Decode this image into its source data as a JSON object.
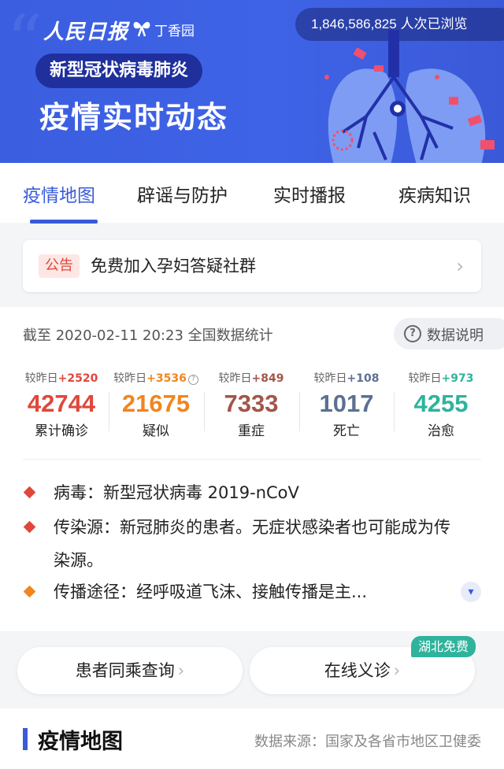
{
  "banner": {
    "brand_primary": "人民日报",
    "brand_cross": "×",
    "brand_partner": "丁香园",
    "views": "1,846,586,825 人次已浏览",
    "subtitle": "新型冠状病毒肺炎",
    "title": "疫情实时动态"
  },
  "tabs": [
    {
      "label": "疫情地图",
      "active": true
    },
    {
      "label": "辟谣与防护",
      "active": false
    },
    {
      "label": "实时播报",
      "active": false
    },
    {
      "label": "疾病知识",
      "active": false
    }
  ],
  "notice": {
    "tag": "公告",
    "text": "免费加入孕妇答疑社群",
    "chevron": "›"
  },
  "stats": {
    "as_of": "截至 2020-02-11 20:23 全国数据统计",
    "explain_label": "数据说明",
    "delta_prefix": "较昨日",
    "items": [
      {
        "delta": "+2520",
        "value": "42744",
        "label": "累计确诊",
        "color": "#e0473a"
      },
      {
        "delta": "+3536",
        "value": "21675",
        "label": "疑似",
        "color": "#f0861e"
      },
      {
        "delta": "+849",
        "value": "7333",
        "label": "重症",
        "color": "#a2564a"
      },
      {
        "delta": "+108",
        "value": "1017",
        "label": "死亡",
        "color": "#5d7092"
      },
      {
        "delta": "+973",
        "value": "4255",
        "label": "治愈",
        "color": "#2fb39c"
      }
    ]
  },
  "info": [
    {
      "text": "病毒：新型冠状病毒 2019-nCoV",
      "bullet_color": "#e0473a"
    },
    {
      "text": "传染源：新冠肺炎的患者。无症状感染者也可能成为传染源。",
      "bullet_color": "#e0473a"
    },
    {
      "text": "传播途径：经呼吸道飞沫、接触传播是主...",
      "bullet_color": "#f0861e"
    }
  ],
  "quick": {
    "same_trip": "患者同乘查询",
    "online_clinic": "在线义诊",
    "hubei_badge": "湖北免费",
    "chevron": "›"
  },
  "map_section": {
    "title": "疫情地图",
    "source": "数据来源：国家及各省市地区卫健委"
  },
  "colors": {
    "accent": "#3a5bd9",
    "banner": "#3f63e6"
  }
}
